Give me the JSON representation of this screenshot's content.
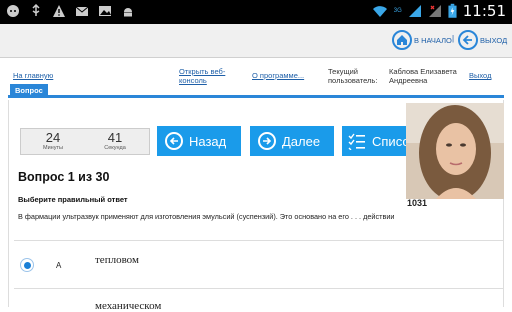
{
  "status_bar": {
    "time": "11:51",
    "icons": [
      "chat-icon",
      "usb-icon",
      "warning-icon",
      "mail-icon",
      "image-icon",
      "android-icon",
      "wifi-icon",
      "signal-icon",
      "signal-x-icon",
      "battery-icon"
    ],
    "network_label": "3G"
  },
  "top_bar": {
    "home_label": "В НАЧАЛО",
    "separator": "|",
    "exit_label": "ВЫХОД"
  },
  "links": {
    "main": "На главную",
    "web_console": "Открыть веб-консоль",
    "about": "О программе...",
    "current_user_label": "Текущий пользователь:",
    "user_name": "Каблова Елизавета Андреевна",
    "logout": "Выход"
  },
  "tab": {
    "label": "Вопрос"
  },
  "timer": {
    "minutes_value": "24",
    "minutes_label": "Минуты",
    "seconds_value": "41",
    "seconds_label": "Секунда"
  },
  "nav": {
    "back_label": "Назад",
    "next_label": "Далее",
    "list_label": "Список"
  },
  "photo": {
    "id": "1031"
  },
  "question": {
    "title": "Вопрос 1 из 30",
    "instruction": "Выберите правильный ответ",
    "text": "В фармации ультразвук применяют для изготовления эмульсий (суспензий). Это основано на его . . . действии"
  },
  "options": [
    {
      "letter": "А",
      "text": "тепловом",
      "selected": true
    },
    {
      "letter": "",
      "text": "механическом",
      "selected": false
    }
  ],
  "colors": {
    "accent": "#1a9bea",
    "link": "#1e5fa8",
    "status_bar": "#000000"
  }
}
